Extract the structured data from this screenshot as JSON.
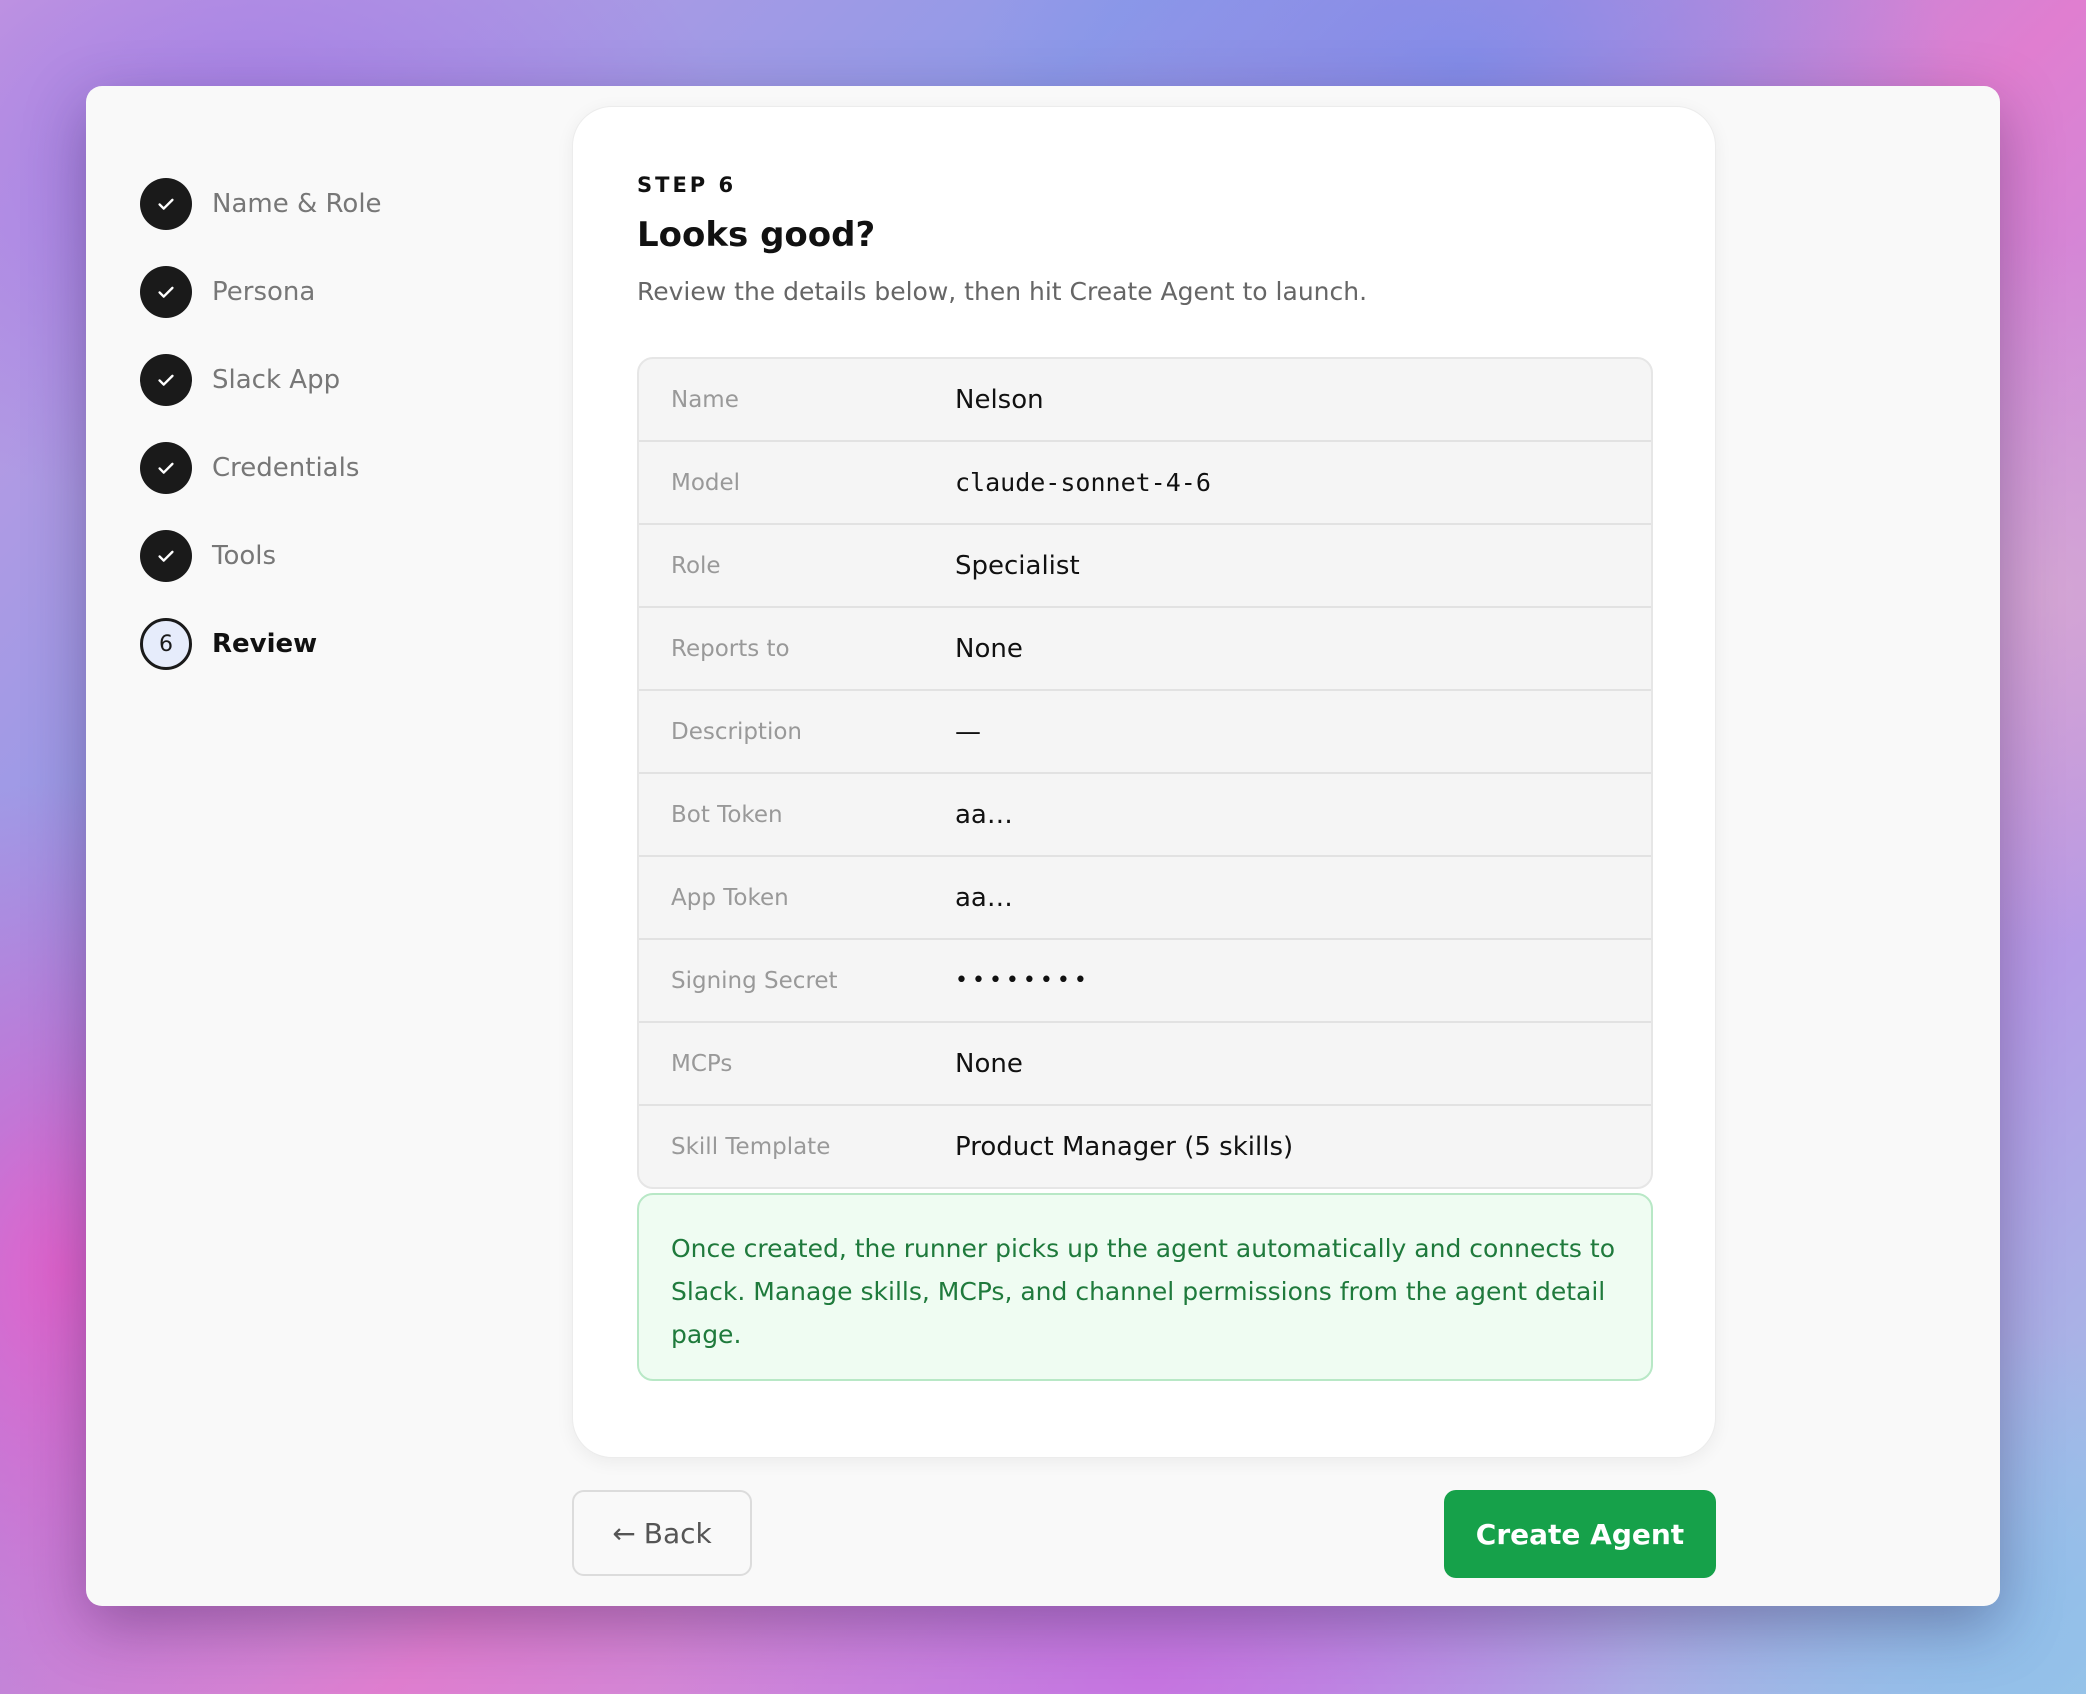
{
  "stepper": {
    "steps": [
      {
        "label": "Name & Role",
        "status": "complete",
        "icon": "check-icon"
      },
      {
        "label": "Persona",
        "status": "complete",
        "icon": "check-icon"
      },
      {
        "label": "Slack App",
        "status": "complete",
        "icon": "check-icon"
      },
      {
        "label": "Credentials",
        "status": "complete",
        "icon": "check-icon"
      },
      {
        "label": "Tools",
        "status": "complete",
        "icon": "check-icon"
      },
      {
        "label": "Review",
        "status": "current",
        "number": "6"
      }
    ]
  },
  "card": {
    "eyebrow": "STEP 6",
    "title": "Looks good?",
    "subtitle": "Review the details below, then hit Create Agent to launch."
  },
  "review": {
    "rows": [
      {
        "label": "Name",
        "value": "Nelson"
      },
      {
        "label": "Model",
        "value": "claude-sonnet-4-6"
      },
      {
        "label": "Role",
        "value": "Specialist"
      },
      {
        "label": "Reports to",
        "value": "None"
      },
      {
        "label": "Description",
        "value": "—"
      },
      {
        "label": "Bot Token",
        "value": "aa…"
      },
      {
        "label": "App Token",
        "value": "aa…"
      },
      {
        "label": "Signing Secret",
        "value": "••••••••"
      },
      {
        "label": "MCPs",
        "value": "None"
      },
      {
        "label": "Skill Template",
        "value": "Product Manager (5 skills)"
      }
    ]
  },
  "info": {
    "text": "Once created, the runner picks up the agent automatically and connects to Slack. Manage skills, MCPs, and channel permissions from the agent detail page."
  },
  "footer": {
    "back_arrow": "←",
    "back_label": "Back",
    "create_label": "Create Agent"
  },
  "colors": {
    "accent_green": "#16a14a",
    "info_text": "#1f7a3c",
    "info_bg": "#effcf2",
    "step_complete": "#1a1a1a"
  }
}
